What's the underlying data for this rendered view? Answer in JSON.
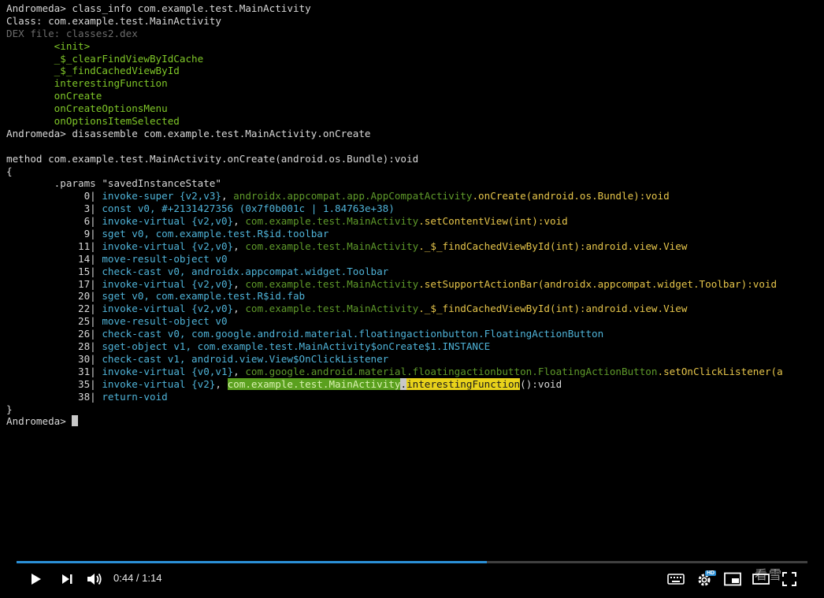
{
  "terminal": {
    "lines": [
      [
        {
          "t": "Andromeda> class_info com.example.test.MainActivity",
          "c": "c-white"
        }
      ],
      [
        {
          "t": "Class: com.example.test.MainActivity",
          "c": "c-white"
        }
      ],
      [
        {
          "t": "DEX file: classes2.dex",
          "c": "c-dim"
        }
      ],
      [
        {
          "t": "        <init>",
          "c": "c-green"
        }
      ],
      [
        {
          "t": "        _$_clearFindViewByIdCache",
          "c": "c-green"
        }
      ],
      [
        {
          "t": "        _$_findCachedViewById",
          "c": "c-green"
        }
      ],
      [
        {
          "t": "        interestingFunction",
          "c": "c-green"
        }
      ],
      [
        {
          "t": "        onCreate",
          "c": "c-green"
        }
      ],
      [
        {
          "t": "        onCreateOptionsMenu",
          "c": "c-green"
        }
      ],
      [
        {
          "t": "        onOptionsItemSelected",
          "c": "c-green"
        }
      ],
      [
        {
          "t": "Andromeda> disassemble com.example.test.MainActivity.onCreate",
          "c": "c-white"
        }
      ],
      [
        {
          "t": "",
          "c": "c-white"
        }
      ],
      [
        {
          "t": "method com.example.test.MainActivity.onCreate(android.os.Bundle):void",
          "c": "c-white"
        }
      ],
      [
        {
          "t": "{",
          "c": "c-white"
        }
      ],
      [
        {
          "t": "        .params \"savedInstanceState\"",
          "c": "c-white"
        }
      ],
      [
        {
          "t": "             0| ",
          "c": "c-white"
        },
        {
          "t": "invoke-super ",
          "c": "c-cyan"
        },
        {
          "t": "{v2,v3}",
          "c": "c-cyan"
        },
        {
          "t": ", ",
          "c": "c-white"
        },
        {
          "t": "androidx.appcompat.app.AppCompatActivity",
          "c": "c-dgreen"
        },
        {
          "t": ".onCreate(android.os.Bundle):void",
          "c": "c-yellow"
        }
      ],
      [
        {
          "t": "             3| ",
          "c": "c-white"
        },
        {
          "t": "const v0, #+2131427356 (0x7f0b001c | 1.84763e+38)",
          "c": "c-cyan"
        }
      ],
      [
        {
          "t": "             6| ",
          "c": "c-white"
        },
        {
          "t": "invoke-virtual ",
          "c": "c-cyan"
        },
        {
          "t": "{v2,v0}",
          "c": "c-cyan"
        },
        {
          "t": ", ",
          "c": "c-white"
        },
        {
          "t": "com.example.test.MainActivity",
          "c": "c-dgreen"
        },
        {
          "t": ".setContentView(int):void",
          "c": "c-yellow"
        }
      ],
      [
        {
          "t": "             9| ",
          "c": "c-white"
        },
        {
          "t": "sget v0, com.example.test.R$id.toolbar",
          "c": "c-cyan"
        }
      ],
      [
        {
          "t": "            11| ",
          "c": "c-white"
        },
        {
          "t": "invoke-virtual ",
          "c": "c-cyan"
        },
        {
          "t": "{v2,v0}",
          "c": "c-cyan"
        },
        {
          "t": ", ",
          "c": "c-white"
        },
        {
          "t": "com.example.test.MainActivity",
          "c": "c-dgreen"
        },
        {
          "t": "._$_findCachedViewById(int):android.view.View",
          "c": "c-yellow"
        }
      ],
      [
        {
          "t": "            14| ",
          "c": "c-white"
        },
        {
          "t": "move-result-object v0",
          "c": "c-cyan"
        }
      ],
      [
        {
          "t": "            15| ",
          "c": "c-white"
        },
        {
          "t": "check-cast v0, androidx.appcompat.widget.Toolbar",
          "c": "c-cyan"
        }
      ],
      [
        {
          "t": "            17| ",
          "c": "c-white"
        },
        {
          "t": "invoke-virtual ",
          "c": "c-cyan"
        },
        {
          "t": "{v2,v0}",
          "c": "c-cyan"
        },
        {
          "t": ", ",
          "c": "c-white"
        },
        {
          "t": "com.example.test.MainActivity",
          "c": "c-dgreen"
        },
        {
          "t": ".setSupportActionBar(androidx.appcompat.widget.Toolbar):void",
          "c": "c-yellow"
        }
      ],
      [
        {
          "t": "            20| ",
          "c": "c-white"
        },
        {
          "t": "sget v0, com.example.test.R$id.fab",
          "c": "c-cyan"
        }
      ],
      [
        {
          "t": "            22| ",
          "c": "c-white"
        },
        {
          "t": "invoke-virtual ",
          "c": "c-cyan"
        },
        {
          "t": "{v2,v0}",
          "c": "c-cyan"
        },
        {
          "t": ", ",
          "c": "c-white"
        },
        {
          "t": "com.example.test.MainActivity",
          "c": "c-dgreen"
        },
        {
          "t": "._$_findCachedViewById(int):android.view.View",
          "c": "c-yellow"
        }
      ],
      [
        {
          "t": "            25| ",
          "c": "c-white"
        },
        {
          "t": "move-result-object v0",
          "c": "c-cyan"
        }
      ],
      [
        {
          "t": "            26| ",
          "c": "c-white"
        },
        {
          "t": "check-cast v0, com.google.android.material.floatingactionbutton.FloatingActionButton",
          "c": "c-cyan"
        }
      ],
      [
        {
          "t": "            28| ",
          "c": "c-white"
        },
        {
          "t": "sget-object v1, com.example.test.MainActivity$onCreate$1.INSTANCE",
          "c": "c-cyan"
        }
      ],
      [
        {
          "t": "            30| ",
          "c": "c-white"
        },
        {
          "t": "check-cast v1, android.view.View$OnClickListener",
          "c": "c-cyan"
        }
      ],
      [
        {
          "t": "            31| ",
          "c": "c-white"
        },
        {
          "t": "invoke-virtual ",
          "c": "c-cyan"
        },
        {
          "t": "{v0,v1}",
          "c": "c-cyan"
        },
        {
          "t": ", ",
          "c": "c-white"
        },
        {
          "t": "com.google.android.material.floatingactionbutton.FloatingActionButton",
          "c": "c-dgreen"
        },
        {
          "t": ".setOnClickListener(a",
          "c": "c-yellow"
        }
      ],
      [
        {
          "t": "            35| ",
          "c": "c-white"
        },
        {
          "t": "invoke-virtual ",
          "c": "c-cyan"
        },
        {
          "t": "{v2}",
          "c": "c-cyan"
        },
        {
          "t": ", ",
          "c": "c-white"
        },
        {
          "t": "com.example.test.MainActivity",
          "c": "hl-green"
        },
        {
          "t": ".",
          "c": "hl-white"
        },
        {
          "t": "interestingFunction",
          "c": "hl-yellow"
        },
        {
          "t": "():void",
          "c": "c-white"
        }
      ],
      [
        {
          "t": "            38| ",
          "c": "c-white"
        },
        {
          "t": "return-void",
          "c": "c-cyan"
        }
      ],
      [
        {
          "t": "}",
          "c": "c-white"
        }
      ],
      [
        {
          "t": "Andromeda> ",
          "c": "c-white"
        },
        {
          "t": "",
          "c": "cursor"
        }
      ]
    ]
  },
  "player": {
    "time_current": "0:44",
    "time_total": "1:14",
    "time_display": "0:44 / 1:14",
    "progress_fraction": 0.5946,
    "hd_badge": "HD",
    "watermark": "看雪",
    "accent_color": "#2b8fd6",
    "icons": {
      "play": "play-icon",
      "next": "next-icon",
      "volume": "volume-icon",
      "captions": "keyboard-icon",
      "settings": "gear-icon",
      "miniplayer": "miniplayer-icon",
      "theater": "theater-icon",
      "fullscreen": "fullscreen-icon"
    }
  }
}
